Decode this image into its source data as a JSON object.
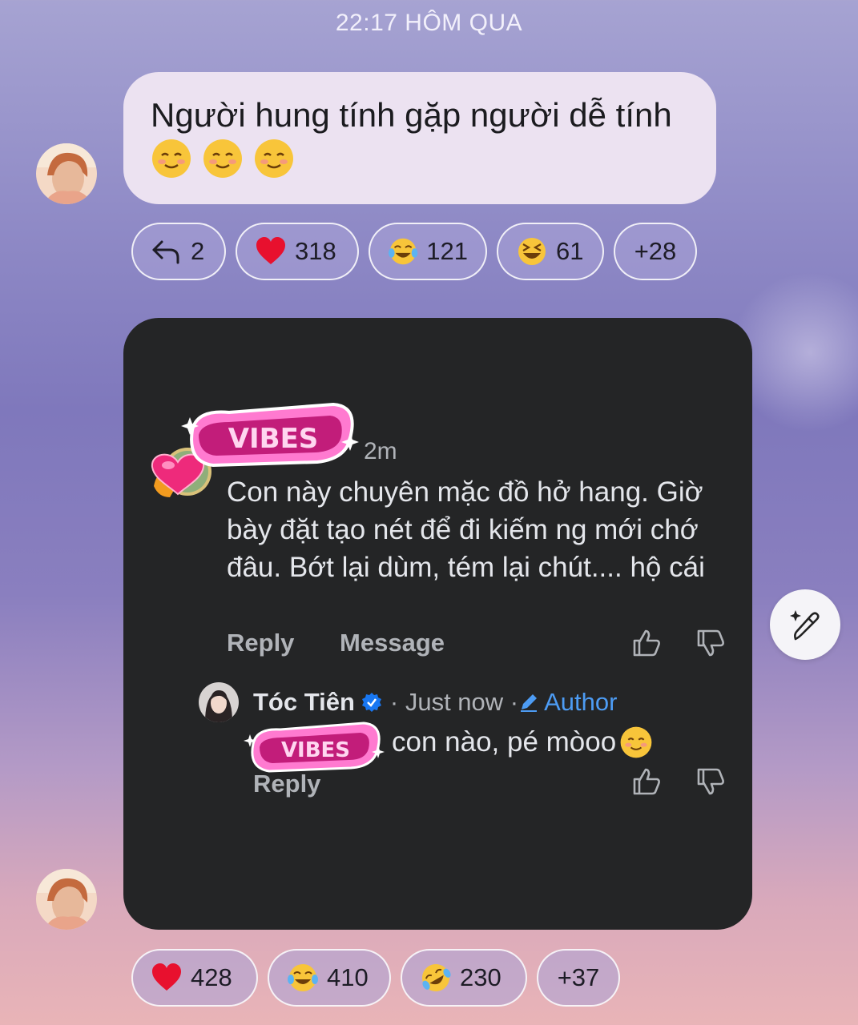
{
  "timestamp": "22:17 HÔM QUA",
  "message1": {
    "text": "Người hung tính gặp người dễ tính",
    "emojis": [
      "☺️",
      "☺️",
      "☺️"
    ]
  },
  "reactions1": [
    {
      "icon": "reply-arrow-icon",
      "count": "2"
    },
    {
      "icon": "heart-emoji",
      "count": "318"
    },
    {
      "icon": "tears-of-joy-emoji",
      "count": "121"
    },
    {
      "icon": "grinning-squint-emoji",
      "count": "61"
    },
    {
      "icon": "",
      "count": "+28"
    }
  ],
  "comment": {
    "time": "2m",
    "text": "Con này chuyên mặc đồ hở hang. Giờ bày đặt tạo nét để đi kiếm ng mới chớ đâu. Bớt lại dùm, tém lại chút.... hộ cái",
    "reply_label": "Reply",
    "message_label": "Message",
    "sticker_text": "VIBES"
  },
  "reply": {
    "name": "Tóc Tiên",
    "meta": "· Just now ·",
    "author_label": "Author",
    "text": "con nào, pé mòoo",
    "reply_label": "Reply"
  },
  "reactions2": [
    {
      "icon": "heart-emoji",
      "count": "428"
    },
    {
      "icon": "tears-of-joy-emoji",
      "count": "410"
    },
    {
      "icon": "rolling-on-floor-laughing-emoji",
      "count": "230"
    },
    {
      "icon": "",
      "count": "+37"
    }
  ],
  "colors": {
    "bubble": "#ece2f1",
    "card": "#242526",
    "author_blue": "#4d9cf4",
    "heart": "#e8102e"
  }
}
